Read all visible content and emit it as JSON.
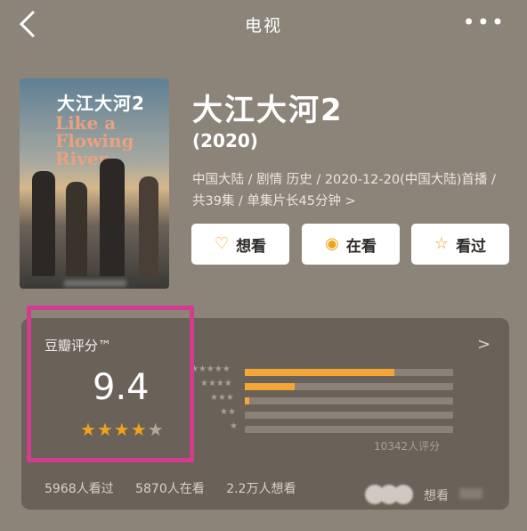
{
  "header": {
    "title": "电视",
    "more_icon": "more-icon"
  },
  "show": {
    "poster_title_cn": "大江大河2",
    "poster_title_en": "Like a Flowing River",
    "title": "大江大河2",
    "year": "(2020)",
    "meta": "中国大陆 / 剧情 历史 / 2020-12-20(中国大陆)首播 / 共39集 / 单集片长45分钟",
    "meta_arrow": ">"
  },
  "actions": {
    "want": {
      "label": "想看",
      "icon": "heart-plus-icon"
    },
    "watching": {
      "label": "在看",
      "icon": "circle-dot-icon"
    },
    "watched": {
      "label": "看过",
      "icon": "star-outline-icon"
    }
  },
  "rating": {
    "label": "豆瓣评分™",
    "value": "9.4",
    "stars": 4.5,
    "count": "10342人评分",
    "distribution": [
      {
        "stars": 5,
        "fraction": 0.72
      },
      {
        "stars": 4,
        "fraction": 0.24
      },
      {
        "stars": 3,
        "fraction": 0.02
      },
      {
        "stars": 2,
        "fraction": 0.0
      },
      {
        "stars": 1,
        "fraction": 0.0
      }
    ]
  },
  "stats": {
    "watched": "5968人看过",
    "watching": "5870人在看",
    "want": "2.2万人想看"
  },
  "friends": {
    "label": "想看"
  },
  "colors": {
    "background": "#8d8479",
    "card": "#6a6158",
    "accent": "#f0a21d",
    "highlight": "#d23c8e"
  }
}
